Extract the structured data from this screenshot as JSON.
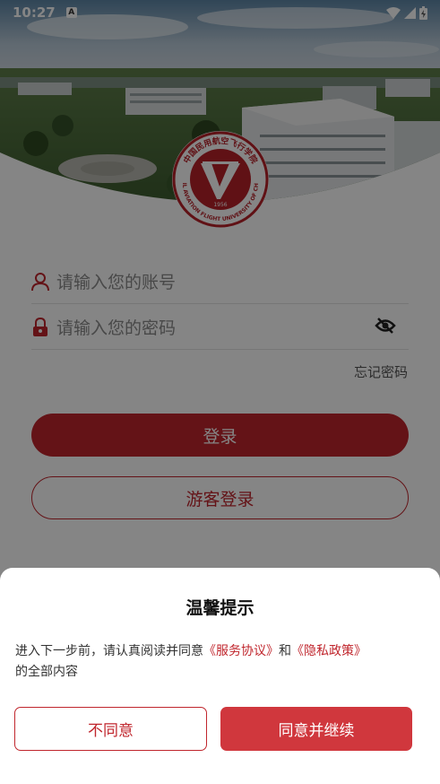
{
  "status_bar": {
    "time": "10:27",
    "notification_badge": "A"
  },
  "logo": {
    "ring_text": "中国民用航空飞行学院",
    "ring_text_en": "CIVIL AVIATION FLIGHT UNIVERSITY OF CHINA",
    "year": "1956"
  },
  "login": {
    "account_placeholder": "请输入您的账号",
    "password_placeholder": "请输入您的密码",
    "forgot_password": "忘记密码",
    "login_button": "登录",
    "guest_button": "游客登录"
  },
  "dialog": {
    "title": "温馨提示",
    "body_prefix": "进入下一步前，请认真阅读并同意",
    "service_link": "《服务协议》",
    "and": "和",
    "privacy_link": "《隐私政策》",
    "body_suffix": "的全部内容",
    "disagree_button": "不同意",
    "agree_button": "同意并继续"
  },
  "colors": {
    "accent": "#c0262d",
    "agree_bg": "#d0373d"
  }
}
